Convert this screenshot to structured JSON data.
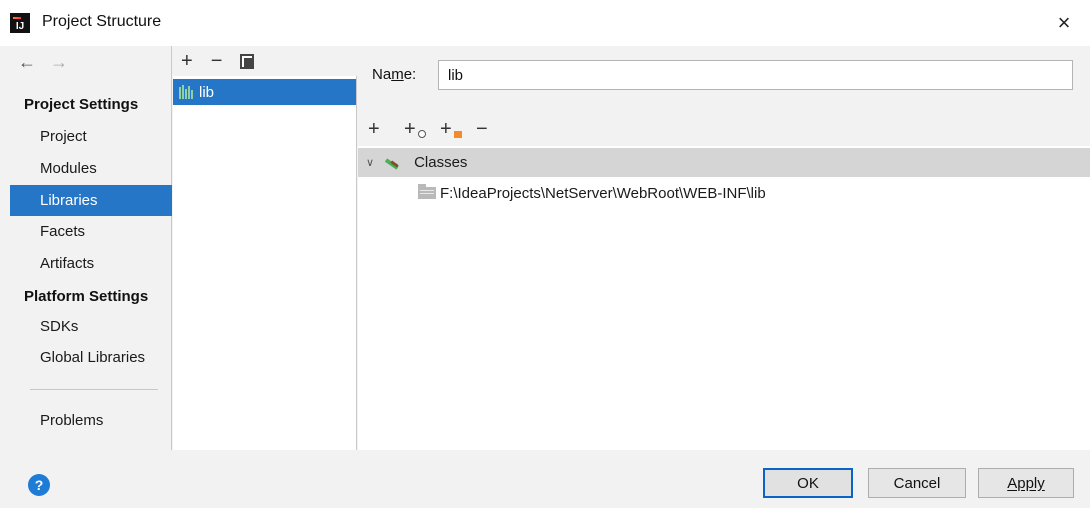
{
  "window": {
    "title": "Project Structure",
    "app_icon_text": "IJ",
    "close_label": "×"
  },
  "nav": {
    "back_arrow": "←",
    "forward_arrow": "→",
    "project_settings_header": "Project Settings",
    "project_items": [
      "Project",
      "Modules",
      "Libraries",
      "Facets",
      "Artifacts"
    ],
    "platform_settings_header": "Platform Settings",
    "platform_items": [
      "SDKs",
      "Global Libraries"
    ],
    "problems_label": "Problems",
    "selected": "Libraries"
  },
  "libraries": {
    "toolbar": {
      "add": "+",
      "remove": "−"
    },
    "items": [
      {
        "label": "lib",
        "selected": true
      }
    ]
  },
  "detail": {
    "name_label_pre": "Na",
    "name_label_mnemonic": "m",
    "name_label_post": "e:",
    "name_value": "lib",
    "toolbar": {
      "add": "+",
      "remove": "−"
    },
    "tree": {
      "root_label": "Classes",
      "children": [
        "F:\\IdeaProjects\\NetServer\\WebRoot\\WEB-INF\\lib"
      ]
    }
  },
  "footer": {
    "help_label": "?",
    "ok_label": "OK",
    "cancel_label": "Cancel",
    "apply_label": "Apply"
  },
  "colors": {
    "selection": "#2676c7",
    "panel_bg": "#f2f2f2",
    "tree_header_bg": "#d5d5d5",
    "help_blue": "#1e7bd6"
  }
}
